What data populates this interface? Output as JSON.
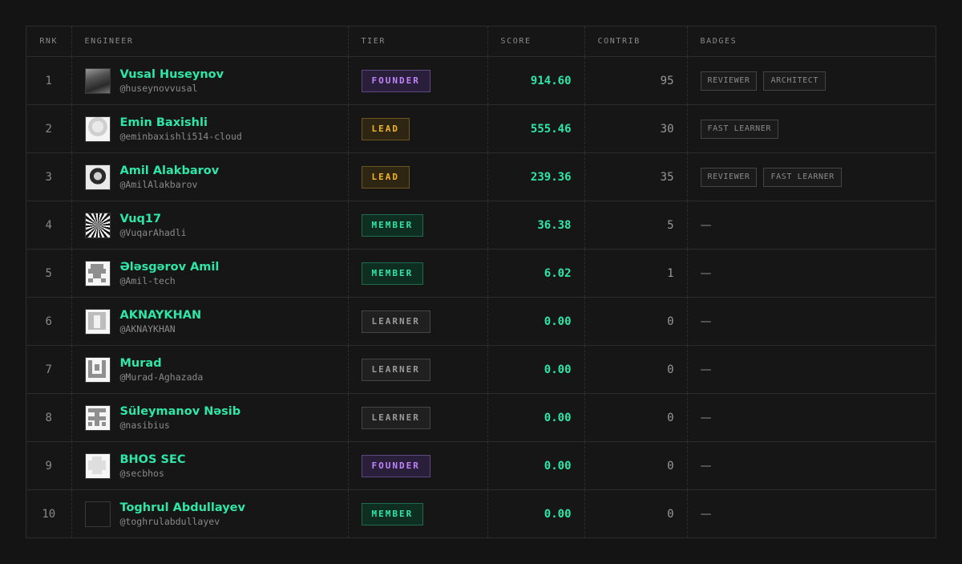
{
  "columns": {
    "rank": "RNK",
    "engineer": "ENGINEER",
    "tier": "TIER",
    "score": "SCORE",
    "contrib": "CONTRIB",
    "badges": "BADGES"
  },
  "colors": {
    "accent": "#2ee6a8",
    "founder": "#c084fc",
    "lead": "#f0b429",
    "member": "#2ee6a8",
    "learner": "#9a9a9a"
  },
  "rows": [
    {
      "rank": "1",
      "name": "Vusal Huseynov",
      "handle": "@huseynovvusal",
      "tier": "FOUNDER",
      "tier_kind": "founder",
      "score": "914.60",
      "contrib": "95",
      "badges": [
        "REVIEWER",
        "ARCHITECT"
      ],
      "avatar": "photo-avatar"
    },
    {
      "rank": "2",
      "name": "Emin Baxishli",
      "handle": "@eminbaxishli514-cloud",
      "tier": "LEAD",
      "tier_kind": "lead",
      "score": "555.46",
      "contrib": "30",
      "badges": [
        "FAST LEARNER"
      ],
      "avatar": "photo-avatar"
    },
    {
      "rank": "3",
      "name": "Amil Alakbarov",
      "handle": "@AmilAlakbarov",
      "tier": "LEAD",
      "tier_kind": "lead",
      "score": "239.36",
      "contrib": "35",
      "badges": [
        "REVIEWER",
        "FAST LEARNER"
      ],
      "avatar": "photo-avatar"
    },
    {
      "rank": "4",
      "name": "Vuq17",
      "handle": "@VuqarAhadli",
      "tier": "MEMBER",
      "tier_kind": "member",
      "score": "36.38",
      "contrib": "5",
      "badges": [],
      "avatar": "photo-avatar"
    },
    {
      "rank": "5",
      "name": "Ələsgərov Amil",
      "handle": "@Amil-tech",
      "tier": "MEMBER",
      "tier_kind": "member",
      "score": "6.02",
      "contrib": "1",
      "badges": [],
      "avatar": "identicon-avatar"
    },
    {
      "rank": "6",
      "name": "AKNAYKHAN",
      "handle": "@AKNAYKHAN",
      "tier": "LEARNER",
      "tier_kind": "learner",
      "score": "0.00",
      "contrib": "0",
      "badges": [],
      "avatar": "identicon-avatar"
    },
    {
      "rank": "7",
      "name": "Murad",
      "handle": "@Murad-Aghazada",
      "tier": "LEARNER",
      "tier_kind": "learner",
      "score": "0.00",
      "contrib": "0",
      "badges": [],
      "avatar": "identicon-avatar"
    },
    {
      "rank": "8",
      "name": "Süleymanov Nəsib",
      "handle": "@nasibius",
      "tier": "LEARNER",
      "tier_kind": "learner",
      "score": "0.00",
      "contrib": "0",
      "badges": [],
      "avatar": "identicon-avatar"
    },
    {
      "rank": "9",
      "name": "BHOS SEC",
      "handle": "@secbhos",
      "tier": "FOUNDER",
      "tier_kind": "founder",
      "score": "0.00",
      "contrib": "0",
      "badges": [],
      "avatar": "identicon-avatar"
    },
    {
      "rank": "10",
      "name": "Toghrul Abdullayev",
      "handle": "@toghrulabdullayev",
      "tier": "MEMBER",
      "tier_kind": "member",
      "score": "0.00",
      "contrib": "0",
      "badges": [],
      "avatar": "empty-avatar"
    }
  ],
  "empty_badge_text": "—"
}
